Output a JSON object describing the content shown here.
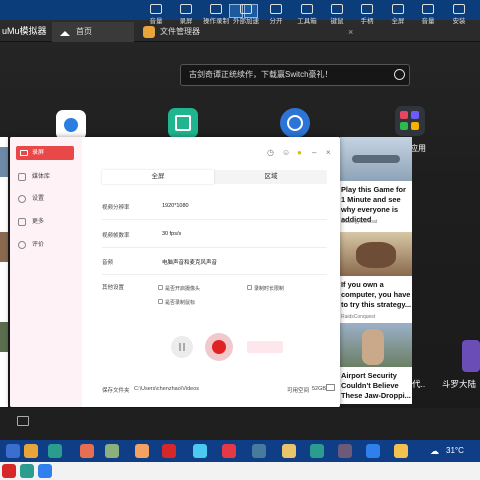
{
  "emulator": {
    "title": "uMu模拟器",
    "tabs": [
      {
        "label": "首页"
      },
      {
        "label": "文件管理器"
      }
    ],
    "tab_close": "×",
    "search_placeholder": "古剑奇谭正统续作，下载赢Switch豪礼！",
    "app_label_right": "应用",
    "toolbar": [
      {
        "label": "音量",
        "icon": "volume-icon"
      },
      {
        "label": "录屏",
        "icon": "record-icon"
      },
      {
        "label": "操作录制",
        "icon": "macro-icon"
      },
      {
        "label": "外部加速",
        "icon": "speed-icon"
      },
      {
        "label": "分开",
        "icon": "split-icon"
      },
      {
        "label": "工具箱",
        "icon": "toolbox-icon"
      },
      {
        "label": "键鼠",
        "icon": "keyboard-icon"
      },
      {
        "label": "手柄",
        "icon": "gamepad-icon"
      },
      {
        "label": "全屏",
        "icon": "fullscreen-icon"
      },
      {
        "label": "音量",
        "icon": "volume-icon"
      },
      {
        "label": "安装",
        "icon": "apk-icon"
      }
    ],
    "right_labels": [
      "代..",
      "斗罗大陆"
    ]
  },
  "recorder": {
    "header": "录屏",
    "menu": [
      {
        "label": "媒体库",
        "icon": "library-icon"
      },
      {
        "label": "设置",
        "icon": "gear-icon"
      },
      {
        "label": "更多",
        "icon": "more-icon"
      },
      {
        "label": "评价",
        "icon": "star-icon"
      }
    ],
    "modes": {
      "active": "全屏",
      "inactive": "区域"
    },
    "settings": [
      {
        "label": "视频分辨率",
        "value": "1920*1080"
      },
      {
        "label": "视频帧数率",
        "value": "30 fps/s"
      },
      {
        "label": "音频",
        "value": "电脑声音和麦克风声音"
      }
    ],
    "other_label": "其他设置",
    "options": [
      {
        "label": "是否开启摄像头"
      },
      {
        "label": "录制时长限制"
      },
      {
        "label": "是否录制鼠标"
      }
    ],
    "save_label": "保存文件夹",
    "save_path": "C:\\Users\\chenzhao\\Videos",
    "space_label": "可用空间",
    "space_value": "52GB"
  },
  "ads": [
    {
      "title": "Play this Game for 1 Minute and see why everyone is addicted",
      "source": "StrategyCombat"
    },
    {
      "title": "If you own a computer, you have to try this strategy...",
      "source": "RaidsConquest"
    },
    {
      "title": "Airport Security Couldn't Believe These Jaw-Droppi...",
      "source": ""
    }
  ],
  "tray": {
    "temperature": "31°C"
  }
}
